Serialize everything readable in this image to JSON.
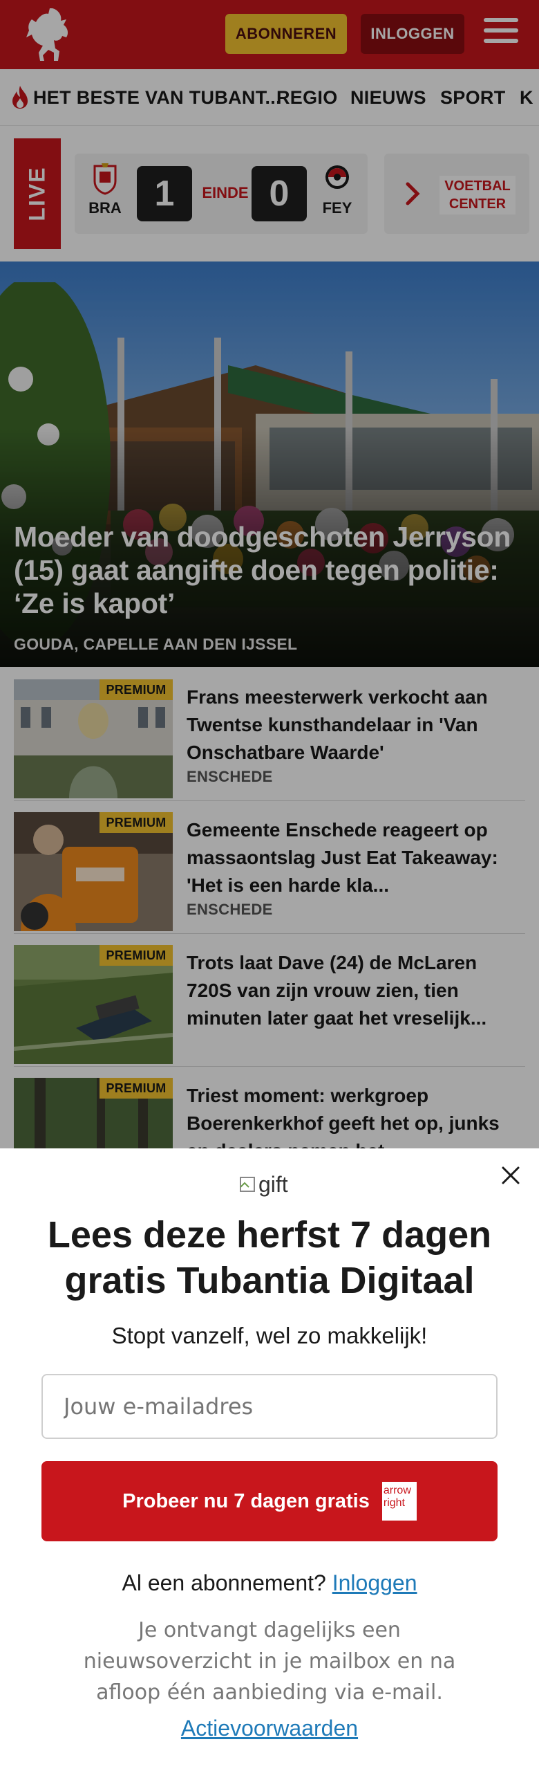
{
  "header": {
    "subscribe_label": "ABONNEREN",
    "login_label": "INLOGGEN",
    "brand_color": "#c8161c"
  },
  "nav": {
    "items": [
      "HET BESTE VAN TUBANT...",
      "REGIO",
      "NIEUWS",
      "SPORT",
      "K"
    ]
  },
  "live": {
    "tag": "LIVE",
    "match": {
      "home_team": "BRA",
      "home_score": "1",
      "status": "EINDE",
      "away_score": "0",
      "away_team": "FEY"
    },
    "voetbal_center": "VOETBAL\nCENTER"
  },
  "hero": {
    "title": "Moeder van doodgeschoten Jerryson (15) gaat aangifte doen tegen politie: ‘Ze is kapot’",
    "location": "GOUDA, CAPELLE AAN DEN IJSSEL"
  },
  "articles": [
    {
      "badge": "PREMIUM",
      "title": "Frans meesterwerk verkocht aan Twentse kunsthandelaar in 'Van Onschatbare Waarde'",
      "location": "ENSCHEDE"
    },
    {
      "badge": "PREMIUM",
      "title": "Gemeente Enschede reageert op massaontslag Just Eat Takeaway: 'Het is een harde kla...",
      "location": "ENSCHEDE"
    },
    {
      "badge": "PREMIUM",
      "title": "Trots laat Dave (24) de McLaren 720S van zijn vrouw zien, tien minuten later gaat het vreselijk...",
      "location": ""
    },
    {
      "badge": "PREMIUM",
      "title": "Triest moment: werkgroep Boerenkerkhof geeft het op, junks en dealers nemen het",
      "location": ""
    }
  ],
  "modal": {
    "gift_alt": "gift",
    "title": "Lees deze herfst 7 dagen gratis Tubantia Digitaal",
    "subtitle": "Stopt vanzelf, wel zo makkelijk!",
    "email_placeholder": "Jouw e-mailadres",
    "cta_label": "Probeer nu 7 dagen gratis",
    "cta_arrow_alt": "arrow right",
    "login_prompt": "Al een abonnement?",
    "login_link": "Inloggen",
    "note": "Je ontvangt dagelijks een nieuwsoverzicht in je mailbox en na afloop één aanbieding via e-mail.",
    "terms": "Actievoorwaarden"
  }
}
